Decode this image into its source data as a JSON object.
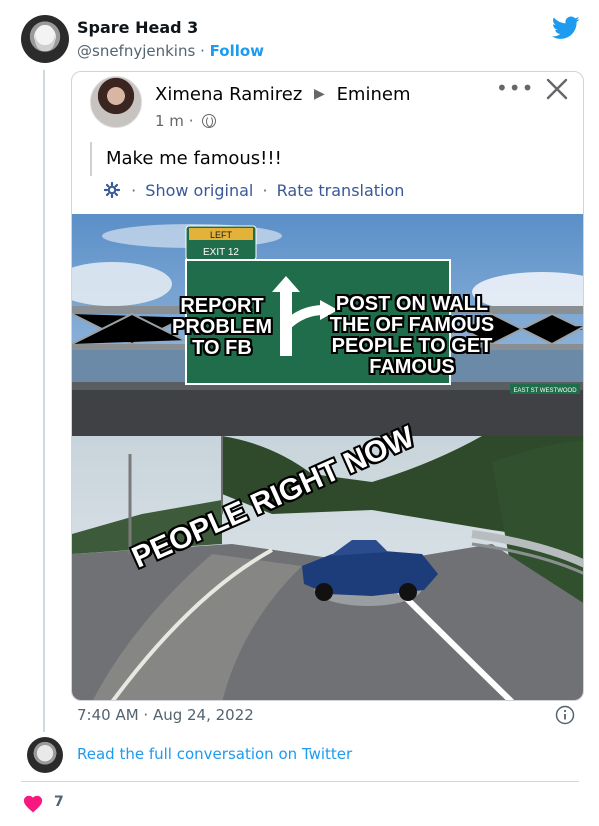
{
  "tweet": {
    "display_name": "Spare Head 3",
    "handle": "@snefnyjenkins",
    "separator": "·",
    "follow_label": "Follow",
    "timestamp": "7:40 AM · Aug 24, 2022",
    "read_more_label": "Read the full conversation on Twitter",
    "like_count": "7",
    "brand_color": "#1d9bf0",
    "heart_color": "#f91880",
    "icons": [
      "twitter-bird-icon",
      "info-icon",
      "heart-icon"
    ]
  },
  "facebook_post": {
    "author": "Ximena Ramirez",
    "arrow": "▶",
    "recipient": "Eminem",
    "meta_time": "1 m",
    "meta_sep": "·",
    "more_label": "•••",
    "text": "Make me famous!!!",
    "translate_sep": "·",
    "show_original": "Show original",
    "rate_translation": "Rate translation",
    "icons": [
      "globe-icon",
      "more-icon",
      "close-icon",
      "gear-icon"
    ]
  },
  "meme": {
    "sign_small_top": "LEFT",
    "sign_small_exit": "EXIT 12",
    "sign_right_small": "EAST ST  WESTWOOD",
    "left_label": "REPORT PROBLEM TO FB",
    "right_label": "POST ON WALL THE OF FAMOUS PEOPLE TO GET FAMOUS",
    "bottom_label": "PEOPLE RIGHT NOW"
  }
}
